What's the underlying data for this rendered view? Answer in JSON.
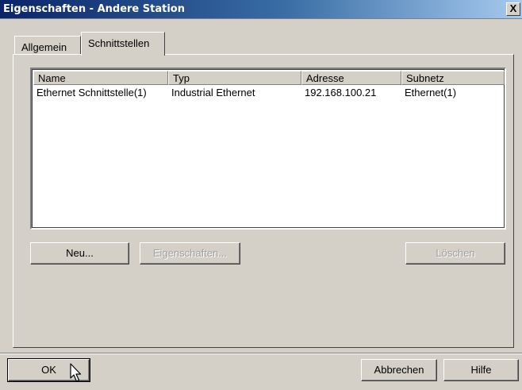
{
  "window": {
    "title": "Eigenschaften - Andere Station",
    "close_label": "X"
  },
  "tabs": [
    {
      "label": "Allgemein"
    },
    {
      "label": "Schnittstellen"
    }
  ],
  "interfaces_table": {
    "columns": [
      "Name",
      "Typ",
      "Adresse",
      "Subnetz"
    ],
    "rows": [
      [
        "Ethernet Schnittstelle(1)",
        "Industrial Ethernet",
        "192.168.100.21",
        "Ethernet(1)"
      ]
    ]
  },
  "buttons": {
    "new": "Neu...",
    "properties": "Eigenschaften...",
    "delete": "Löschen",
    "ok": "OK",
    "cancel": "Abbrechen",
    "help": "Hilfe"
  }
}
